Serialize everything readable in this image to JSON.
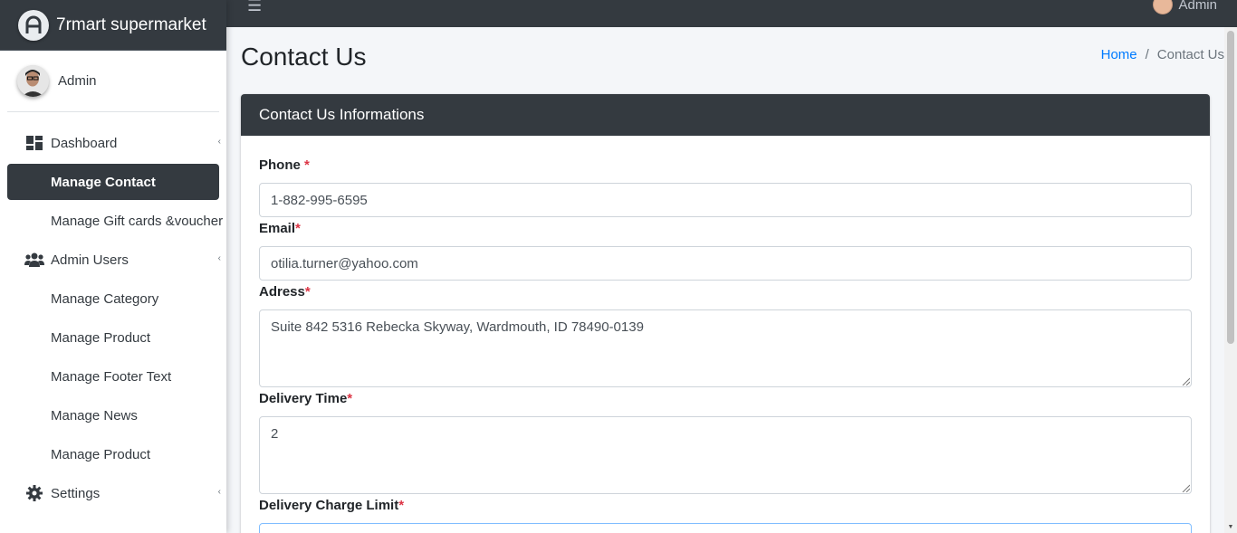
{
  "brand": {
    "name": "7rmart supermarket"
  },
  "user": {
    "name": "Admin"
  },
  "topbar": {
    "user_name": "Admin"
  },
  "sidebar": {
    "items": [
      {
        "label": "Dashboard"
      },
      {
        "label": "Manage Contact"
      },
      {
        "label": "Manage Gift cards &voucher"
      },
      {
        "label": "Admin Users"
      },
      {
        "label": "Manage Category"
      },
      {
        "label": "Manage Product"
      },
      {
        "label": "Manage Footer Text"
      },
      {
        "label": "Manage News"
      },
      {
        "label": "Manage Product"
      },
      {
        "label": "Settings"
      }
    ]
  },
  "page": {
    "title": "Contact Us",
    "breadcrumb": {
      "home": "Home",
      "separator": "/",
      "current": "Contact Us"
    }
  },
  "card": {
    "title": "Contact Us Informations",
    "fields": {
      "phone": {
        "label": "Phone",
        "required": "*",
        "value": "1-882-995-6595"
      },
      "email": {
        "label": "Email",
        "required": "*",
        "value": "otilia.turner@yahoo.com"
      },
      "address": {
        "label": "Adress",
        "required": "*",
        "value": "Suite 842 5316 Rebecka Skyway, Wardmouth, ID 78490-0139"
      },
      "delivery_time": {
        "label": "Delivery Time",
        "required": "*",
        "value": "2"
      },
      "delivery_charge_limit": {
        "label": "Delivery Charge Limit",
        "required": "*",
        "value": ""
      }
    }
  },
  "colors": {
    "sidebar_dark": "#343a40",
    "link": "#007bff",
    "required": "#dc3545",
    "focus_border": "#80bdff"
  }
}
